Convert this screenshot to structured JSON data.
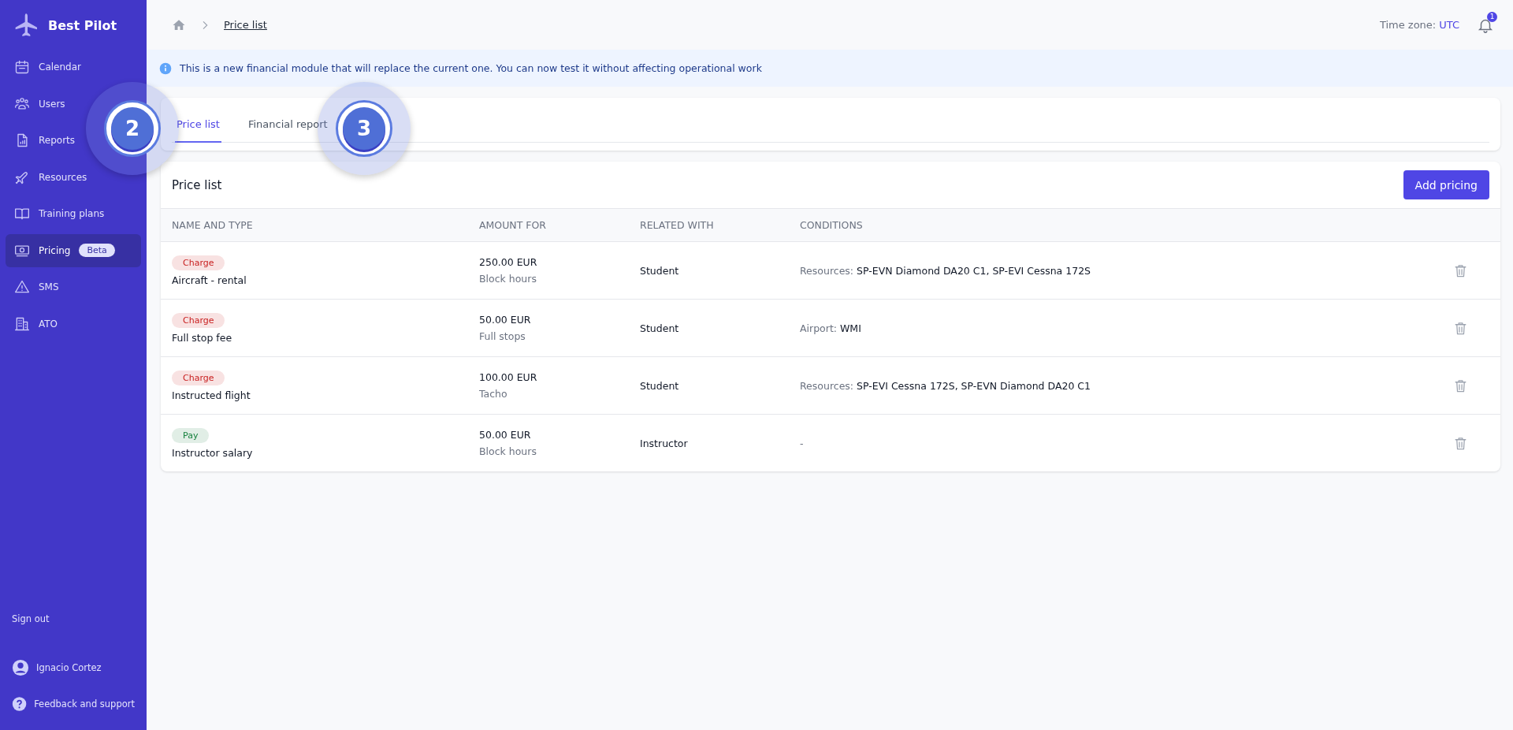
{
  "sidebar": {
    "brand": "Best Pilot",
    "items": [
      {
        "label": "Calendar",
        "selected": false
      },
      {
        "label": "Users",
        "selected": false
      },
      {
        "label": "Reports",
        "selected": false
      },
      {
        "label": "Resources",
        "selected": false
      },
      {
        "label": "Training plans",
        "selected": false
      },
      {
        "label": "Pricing",
        "badge": "Beta",
        "selected": true
      },
      {
        "label": "SMS",
        "selected": false
      },
      {
        "label": "ATO",
        "selected": false
      }
    ],
    "sign_out": "Sign out",
    "user": "Ignacio Cortez",
    "feedback": "Feedback and support"
  },
  "breadcrumb": {
    "current": "Price list"
  },
  "timezone": {
    "label": "Time zone:",
    "value": "UTC"
  },
  "notifications": {
    "count": "1"
  },
  "banner": "This is a new financial module that will replace the current one. You can now test it without affecting operational work",
  "tabs": [
    {
      "label": "Price list",
      "selected": true
    },
    {
      "label": "Financial report",
      "selected": false
    }
  ],
  "table": {
    "title": "Price list",
    "add_button": "Add pricing",
    "columns": [
      "NAME AND TYPE",
      "AMOUNT FOR",
      "RELATED WITH",
      "CONDITIONS"
    ],
    "rows": [
      {
        "color": "#c81e1e",
        "tag": "Charge",
        "name": "Aircraft - rental",
        "amount": "250.00 EUR",
        "unit": "Block hours",
        "related": "Student",
        "condition_label": "Resources:",
        "condition_value": "SP-EVN Diamond DA20 C1, SP-EVI Cessna 172S"
      },
      {
        "color": "#c81e1e",
        "tag": "Charge",
        "name": "Full stop fee",
        "amount": "50.00 EUR",
        "unit": "Full stops",
        "related": "Student",
        "condition_label": "Airport:",
        "condition_value": "WMI"
      },
      {
        "color": "#c81e1e",
        "tag": "Charge",
        "name": "Instructed flight",
        "amount": "100.00 EUR",
        "unit": "Tacho",
        "related": "Student",
        "condition_label": "Resources:",
        "condition_value": "SP-EVI Cessna 172S, SP-EVN Diamond DA20 C1"
      },
      {
        "color": "#15803d",
        "tag": "Pay",
        "name": "Instructor salary",
        "amount": "50.00 EUR",
        "unit": "Block hours",
        "related": "Instructor",
        "condition_label": "-"
      }
    ]
  },
  "step_markers": [
    "2",
    "3"
  ]
}
